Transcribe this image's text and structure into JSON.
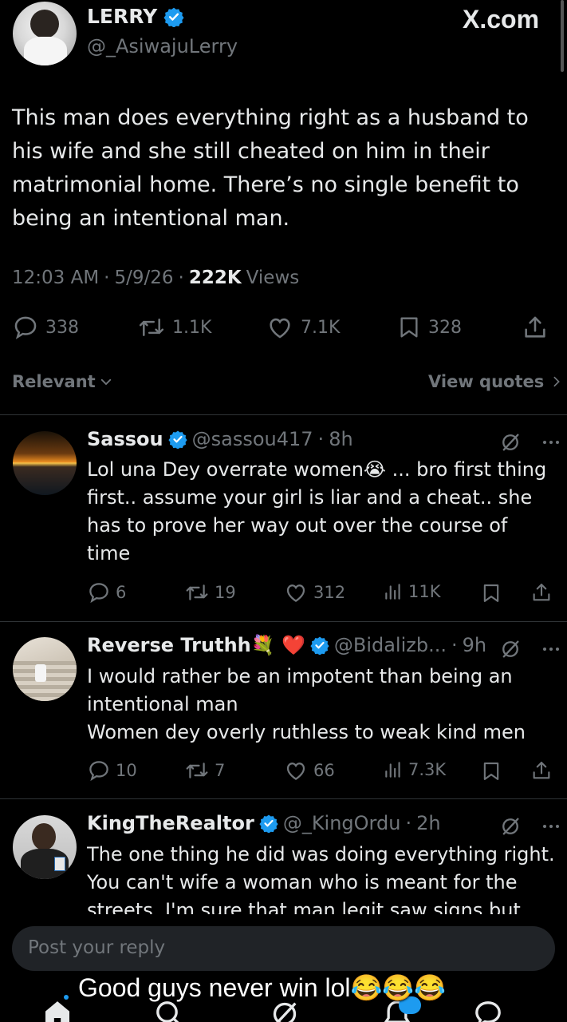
{
  "header": {
    "brand": "X.com"
  },
  "post": {
    "author_name": "LERRY",
    "author_handle": "@_AsiwajuLerry",
    "text": "This man does everything right as a husband to his wife and she still cheated on him in their matrimonial home. There’s no single benefit to being an intentional man.",
    "time": "12:03 AM",
    "date": "5/9/26",
    "views_count": "222K",
    "views_label": "Views",
    "replies": "338",
    "reposts": "1.1K",
    "likes": "7.1K",
    "bookmarks": "328"
  },
  "sort": {
    "label": "Relevant",
    "view_quotes": "View quotes"
  },
  "replies": [
    {
      "name": "Sassou",
      "handle": "@sassou417",
      "age": "8h",
      "text_lines": [
        "Lol una Dey overrate women😭 ... bro first thing",
        "first.. assume your girl is liar and a cheat.. she",
        "has to prove her way out over the course of",
        "time"
      ],
      "replies": "6",
      "reposts": "19",
      "likes": "312",
      "views": "11K"
    },
    {
      "name": "Reverse Truthh💐 ❤️",
      "handle": "@Bidalizb...",
      "age": "9h",
      "text_lines": [
        "I would rather be an impotent than being an",
        "intentional man",
        "Women dey overly ruthless to weak kind men"
      ],
      "replies": "10",
      "reposts": "7",
      "likes": "66",
      "views": "7.3K"
    },
    {
      "name": "KingTheRealtor",
      "handle": "@_KingOrdu",
      "age": "2h",
      "text_lines": [
        "The one thing he did was doing everything right.",
        "You can't wife a woman who is meant for the",
        "streets. I'm sure that man legit saw signs but"
      ],
      "replies": "",
      "reposts": "",
      "likes": "",
      "views": ""
    }
  ],
  "composer": {
    "placeholder": "Post your reply"
  },
  "caption": "Good guys never win lol😂😂😂",
  "colors": {
    "background": "#000000",
    "text": "#e7e9ea",
    "muted": "#71767b",
    "verified": "#1d9bf0",
    "divider": "#2f3336"
  },
  "icons": [
    "verified-badge-icon",
    "reply-icon",
    "repost-icon",
    "like-icon",
    "bookmark-icon",
    "share-icon",
    "views-icon",
    "grok-icon",
    "more-icon",
    "chevron-down-icon",
    "chevron-right-icon",
    "home-icon",
    "search-icon",
    "notifications-icon",
    "messages-icon"
  ]
}
